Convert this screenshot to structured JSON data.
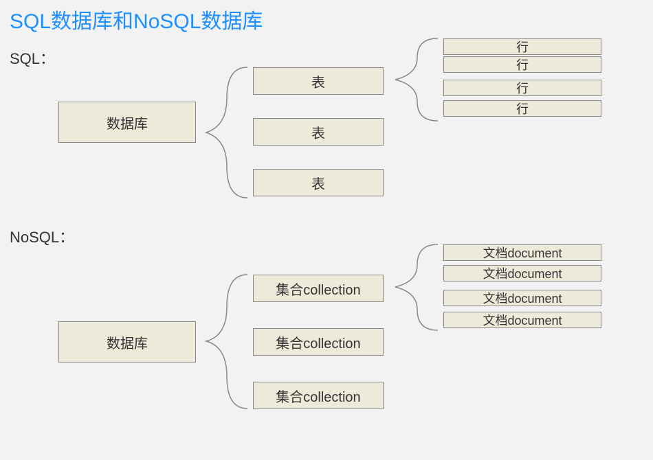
{
  "title": "SQL数据库和NoSQL数据库",
  "sql": {
    "label": "SQL：",
    "db": "数据库",
    "tables": [
      "表",
      "表",
      "表"
    ],
    "rows": [
      "行",
      "行",
      "行",
      "行"
    ]
  },
  "nosql": {
    "label": "NoSQL：",
    "db": "数据库",
    "collections": [
      "集合collection",
      "集合collection",
      "集合collection"
    ],
    "documents": [
      "文档document",
      "文档document",
      "文档document",
      "文档document"
    ]
  }
}
